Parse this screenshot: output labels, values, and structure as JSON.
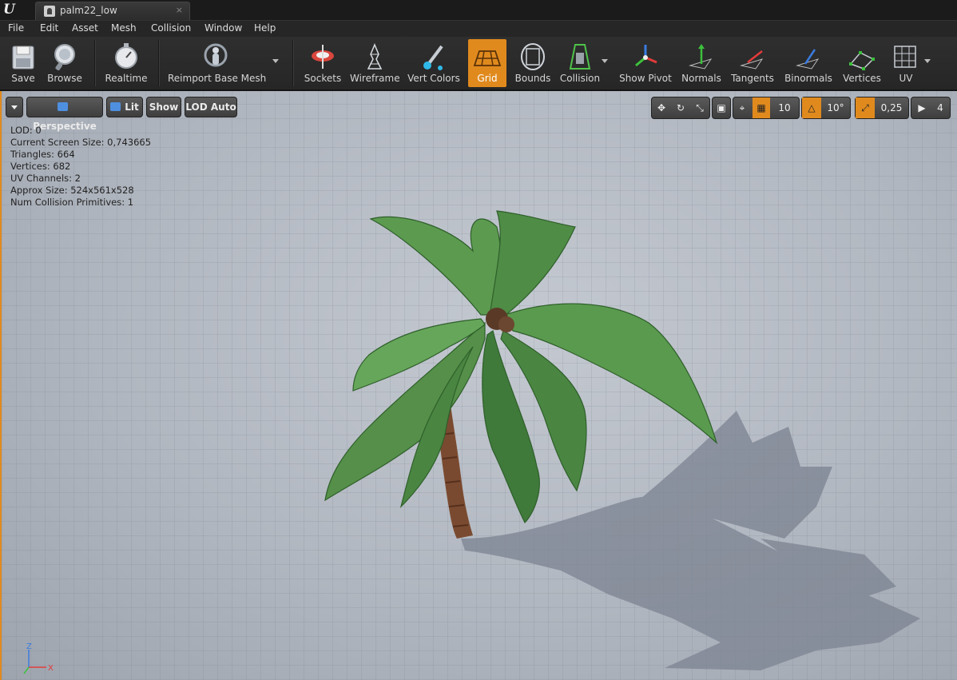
{
  "window": {
    "tab_title": "palm22_low",
    "tab_close": "×",
    "logo_glyph": "U"
  },
  "menu": [
    "File",
    "Edit",
    "Asset",
    "Mesh",
    "Collision",
    "Window",
    "Help"
  ],
  "toolbar": {
    "items": [
      {
        "label": "Save",
        "icon": "save-icon"
      },
      {
        "label": "Browse",
        "icon": "browse-icon"
      },
      {
        "label": "Realtime",
        "icon": "realtime-icon"
      },
      {
        "label": "Reimport Base Mesh",
        "icon": "reimport-icon"
      },
      {
        "label": "Sockets",
        "icon": "sockets-icon"
      },
      {
        "label": "Wireframe",
        "icon": "wireframe-icon"
      },
      {
        "label": "Vert Colors",
        "icon": "vert-colors-icon"
      },
      {
        "label": "Grid",
        "icon": "grid-icon",
        "active": true
      },
      {
        "label": "Bounds",
        "icon": "bounds-icon"
      },
      {
        "label": "Collision",
        "icon": "collision-icon"
      },
      {
        "label": "Show Pivot",
        "icon": "pivot-icon"
      },
      {
        "label": "Normals",
        "icon": "normals-icon"
      },
      {
        "label": "Tangents",
        "icon": "tangents-icon"
      },
      {
        "label": "Binormals",
        "icon": "binormals-icon"
      },
      {
        "label": "Vertices",
        "icon": "vertices-icon"
      },
      {
        "label": "UV",
        "icon": "uv-icon"
      }
    ]
  },
  "viewport": {
    "perspective_label": "Perspective",
    "lit_label": "Lit",
    "show_label": "Show",
    "lod_label": "LOD Auto",
    "grid_snap_value": "10",
    "rotation_snap_value": "10°",
    "scale_snap_value": "0,25",
    "camera_speed_value": "4",
    "axis_labels": {
      "z": "Z",
      "x": "X"
    }
  },
  "stats": [
    "LOD:  0",
    "Current Screen Size:  0,743665",
    "Triangles:  664",
    "Vertices:  682",
    "UV Channels:  2",
    "Approx Size: 524x561x528",
    "Num Collision Primitives:  1"
  ],
  "colors": {
    "accent": "#e08a1e",
    "leaf": "#4f8c46",
    "trunk": "#7a4a30",
    "shadow": "#6f7684"
  }
}
